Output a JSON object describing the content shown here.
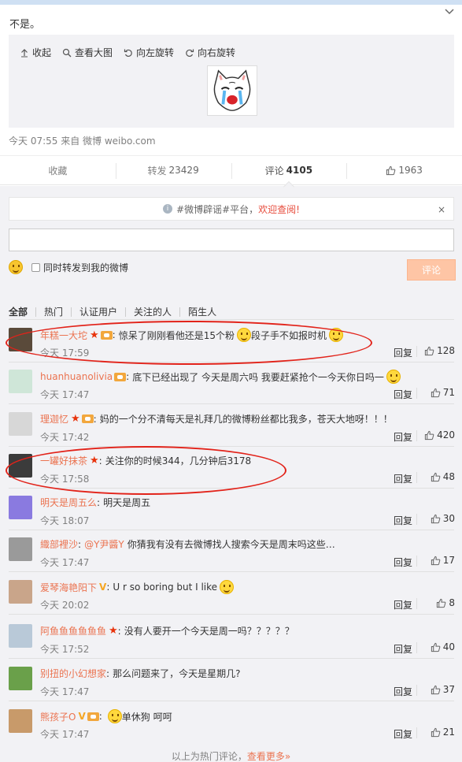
{
  "post": {
    "text": "不是。",
    "meta": "今天 07:55 来自 微博 weibo.com"
  },
  "media_tools": [
    {
      "label": "收起",
      "icon": "arrow-up-icon"
    },
    {
      "label": "查看大图",
      "icon": "magnifier-icon"
    },
    {
      "label": "向左旋转",
      "icon": "rotate-left-icon"
    },
    {
      "label": "向右旋转",
      "icon": "rotate-right-icon"
    }
  ],
  "actions": {
    "favorite": "收藏",
    "repost_label": "转发",
    "repost_count": "23429",
    "comment_label": "评论",
    "comment_count": "4105",
    "like_count": "1963"
  },
  "notice": {
    "prefix": "#微博辟谣#平台，",
    "link": "欢迎查阅!",
    "close": "×"
  },
  "comment_form": {
    "input_value": "",
    "forward_label": "同时转发到我的微博",
    "submit_label": "评论"
  },
  "filters": [
    "全部",
    "热门",
    "认证用户",
    "关注的人",
    "陌生人"
  ],
  "comments": [
    {
      "user": "年糕一大坨",
      "badges": [
        "star",
        "crown"
      ],
      "text": "惊呆了刚刚看他还是15个粉",
      "emoji_mid": true,
      "text2": "段子手不如报时机",
      "emoji_end": true,
      "time": "今天 17:59",
      "likes": "128"
    },
    {
      "user": "huanhuanolivia",
      "badges": [
        "crown"
      ],
      "text": "底下已经出现了 今天是周六吗 我要赶紧抢个一今天你日吗一",
      "emoji_end": true,
      "time": "今天 17:47",
      "likes": "71"
    },
    {
      "user": "理迦忆",
      "badges": [
        "star",
        "crown"
      ],
      "text": "妈的一个分不清每天是礼拜几的微博粉丝都比我多，苍天大地呀！！！",
      "time": "今天 17:42",
      "likes": "420"
    },
    {
      "user": "一罐好抹茶",
      "badges": [
        "star"
      ],
      "text": "关注你的时候344，几分钟后3178",
      "time": "今天 17:58",
      "likes": "48"
    },
    {
      "user": "明天是周五么",
      "badges": [],
      "text": "明天是周五",
      "time": "今天 18:07",
      "likes": "30"
    },
    {
      "user": "織部裡沙",
      "badges": [],
      "mention": "@Y尹醬Y",
      "text": "你猜我有没有去微博找人搜索今天是周末吗这些…",
      "time": "今天 17:47",
      "likes": "17"
    },
    {
      "user": "爱琴海艳阳下",
      "badges": [
        "v"
      ],
      "text": "U r so boring but I like",
      "emoji_end": true,
      "time": "今天 20:02",
      "likes": "8"
    },
    {
      "user": "阿鱼鱼鱼鱼鱼鱼",
      "badges": [
        "star"
      ],
      "text": "没有人要开一个今天是周一吗？？？？？",
      "time": "今天 17:52",
      "likes": "40"
    },
    {
      "user": "别扭的小幻想家",
      "badges": [],
      "text": "那么问题来了，今天是星期几?",
      "time": "今天 17:47",
      "likes": "37"
    },
    {
      "user": "熊孩子O",
      "badges": [
        "v",
        "crown"
      ],
      "emoji_start": true,
      "text": "单休狗 呵呵",
      "time": "今天 17:47",
      "likes": "21"
    }
  ],
  "reply_label": "回复",
  "footer": {
    "text": "以上为热门评论，",
    "more": "查看更多»"
  },
  "colors": {
    "username": "#eb7350",
    "highlight_circle": "#e2231a",
    "submit_bg": "#fec5a5"
  }
}
